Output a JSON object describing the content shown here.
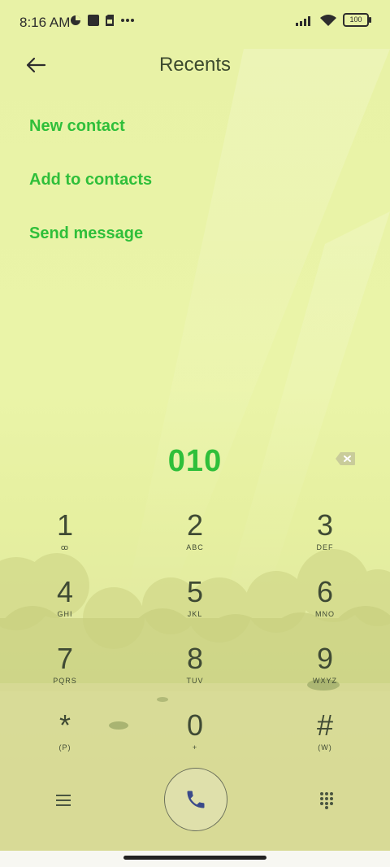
{
  "status_bar": {
    "time": "8:16 AM",
    "battery": "100"
  },
  "header": {
    "title": "Recents"
  },
  "menu": {
    "items": [
      {
        "label": "New contact"
      },
      {
        "label": "Add to contacts"
      },
      {
        "label": "Send message"
      }
    ]
  },
  "dialer": {
    "number": "010",
    "keys": [
      {
        "digit": "1",
        "letters": "ꝏ"
      },
      {
        "digit": "2",
        "letters": "ABC"
      },
      {
        "digit": "3",
        "letters": "DEF"
      },
      {
        "digit": "4",
        "letters": "GHI"
      },
      {
        "digit": "5",
        "letters": "JKL"
      },
      {
        "digit": "6",
        "letters": "MNO"
      },
      {
        "digit": "7",
        "letters": "PQRS"
      },
      {
        "digit": "8",
        "letters": "TUV"
      },
      {
        "digit": "9",
        "letters": "WXYZ"
      },
      {
        "digit": "*",
        "letters": "(P)"
      },
      {
        "digit": "0",
        "letters": "+"
      },
      {
        "digit": "#",
        "letters": "(W)"
      }
    ]
  },
  "colors": {
    "accent": "#2fbf3a",
    "text": "#3f4a34"
  },
  "icons": {
    "back": "arrow-left-icon",
    "backspace": "backspace-icon",
    "call": "phone-icon",
    "menu": "hamburger-icon",
    "dialpad": "dialpad-icon"
  }
}
